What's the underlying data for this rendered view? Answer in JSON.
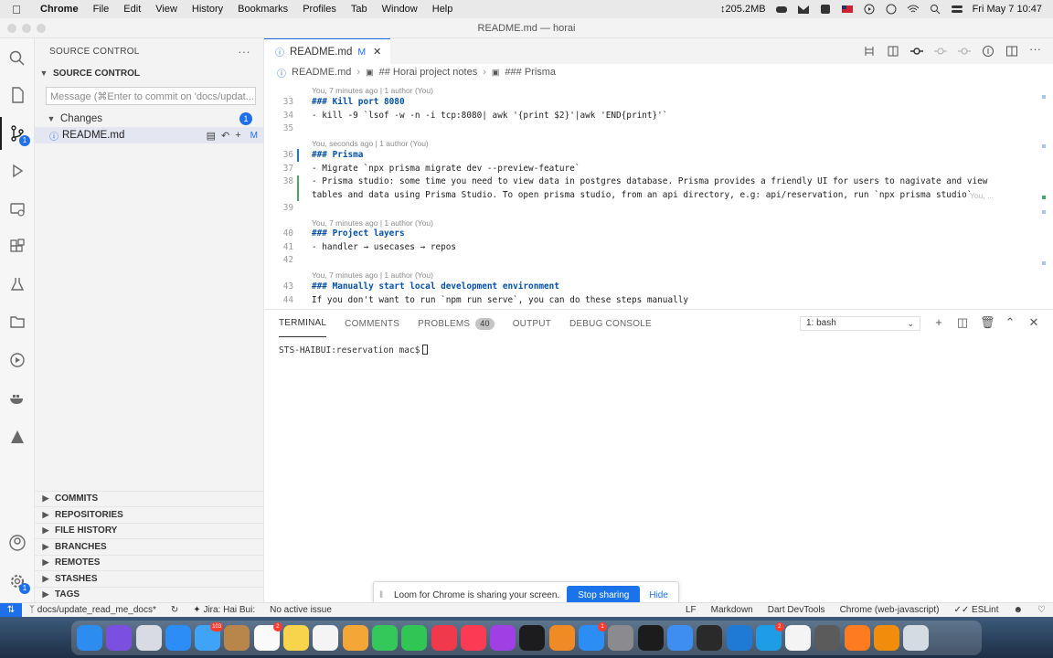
{
  "menubar": {
    "app": "Chrome",
    "menus": [
      "File",
      "Edit",
      "View",
      "History",
      "Bookmarks",
      "Profiles",
      "Tab",
      "Window",
      "Help"
    ],
    "memory": "↕205.2MB",
    "datetime": "Fri May 7  10:47"
  },
  "window": {
    "title": "README.md — horai"
  },
  "sidebar": {
    "header": "SOURCE CONTROL",
    "more": "···",
    "section": "SOURCE CONTROL",
    "commit_placeholder": "Message (⌘Enter to commit on 'docs/updat...",
    "changes_label": "Changes",
    "changes_count": "1",
    "file": {
      "name": "README.md",
      "status": "M"
    },
    "bottom_sections": [
      "COMMITS",
      "REPOSITORIES",
      "FILE HISTORY",
      "BRANCHES",
      "REMOTES",
      "STASHES",
      "TAGS"
    ]
  },
  "activity": {
    "scm_badge": "1",
    "accounts_badge": "1"
  },
  "tab": {
    "label": "README.md",
    "modified": "M",
    "close": "✕"
  },
  "breadcrumb": [
    "README.md",
    "## Horai project notes",
    "### Prisma"
  ],
  "editor": {
    "lines": [
      {
        "blame": "You, 7 minutes ago | 1 author (You)"
      },
      {
        "num": "33",
        "text": "### Kill port 8080",
        "head": true
      },
      {
        "num": "34",
        "text": "-  kill -9 `lsof -w -n -i tcp:8080| awk '{print $2}'|awk 'END{print}'`"
      },
      {
        "num": "35",
        "text": ""
      },
      {
        "blame": "You, seconds ago | 1 author (You)"
      },
      {
        "num": "36",
        "text": "### Prisma",
        "head": true
      },
      {
        "num": "37",
        "text": "- Migrate `npx prisma migrate dev --preview-feature`"
      },
      {
        "num": "38",
        "text": "- Prisma studio: some time you need to view data in postgres database. Prisma provides a friendly UI for users to nagivate and view"
      },
      {
        "num": "",
        "text": "tables and data using Prisma Studio. To open prisma studio, from an api directory, e.g: api/reservation, run `npx prisma studio`"
      },
      {
        "num": "39",
        "text": ""
      },
      {
        "blame": "You, 7 minutes ago | 1 author (You)"
      },
      {
        "num": "40",
        "text": "### Project layers",
        "head": true
      },
      {
        "num": "41",
        "text": "- handler → usecases → repos"
      },
      {
        "num": "42",
        "text": ""
      },
      {
        "blame": "You, 7 minutes ago | 1 author (You)"
      },
      {
        "num": "43",
        "text": "### Manually start local development environment",
        "head": true
      },
      {
        "num": "44",
        "text": "If you don't want to run `npm run serve`, you can do these steps manually"
      }
    ],
    "ghost_blame": "You, ..."
  },
  "panel": {
    "tabs": [
      "TERMINAL",
      "COMMENTS",
      "PROBLEMS",
      "OUTPUT",
      "DEBUG CONSOLE"
    ],
    "problems_count": "40",
    "terminal_select": "1: bash",
    "prompt": "STS-HAIBUI:reservation mac$"
  },
  "loom": {
    "message": "Loom for Chrome is sharing your screen.",
    "stop": "Stop sharing",
    "hide": "Hide"
  },
  "statusbar": {
    "branch": "docs/update_read_me_docs*",
    "jira": "Jira: Hai Bui:",
    "issue": "No active issue",
    "eol": "LF",
    "language": "Markdown",
    "devtools": "Dart DevTools",
    "chrome": "Chrome (web-javascript)",
    "eslint": "ESLint"
  },
  "dock": {
    "apps": [
      {
        "name": "finder-icon",
        "color": "#2d8cf0"
      },
      {
        "name": "siri-icon",
        "color": "#7b4fe0"
      },
      {
        "name": "launchpad-icon",
        "color": "#d8dbe3"
      },
      {
        "name": "safari-icon",
        "color": "#2b8df5"
      },
      {
        "name": "mail-icon",
        "color": "#3fa4f7",
        "badge": "103"
      },
      {
        "name": "contacts-icon",
        "color": "#b8864a"
      },
      {
        "name": "calendar-icon",
        "color": "#fafafa",
        "badge": "2"
      },
      {
        "name": "notes-icon",
        "color": "#f7d44c"
      },
      {
        "name": "reminders-icon",
        "color": "#f4f4f4"
      },
      {
        "name": "photos-icon",
        "color": "#f4a637"
      },
      {
        "name": "messages-icon",
        "color": "#34c759"
      },
      {
        "name": "facetime-icon",
        "color": "#31c653"
      },
      {
        "name": "news-icon",
        "color": "#f03a4b"
      },
      {
        "name": "music-icon",
        "color": "#fa3b53"
      },
      {
        "name": "podcasts-icon",
        "color": "#a03fe3"
      },
      {
        "name": "tv-icon",
        "color": "#1c1c1e"
      },
      {
        "name": "books-icon",
        "color": "#f08a24"
      },
      {
        "name": "appstore-icon",
        "color": "#2c8ef5",
        "badge": "1"
      },
      {
        "name": "system-preferences-icon",
        "color": "#8b8b8f"
      },
      {
        "name": "terminal-icon",
        "color": "#1c1c1c"
      },
      {
        "name": "xcode-icon",
        "color": "#3d8ef0"
      },
      {
        "name": "activity-monitor-icon",
        "color": "#2a2a2a"
      },
      {
        "name": "vscode-icon",
        "color": "#1f7ad6"
      },
      {
        "name": "skype-icon",
        "color": "#1e9ce6",
        "badge": "2"
      },
      {
        "name": "chrome-icon",
        "color": "#f4f4f4"
      },
      {
        "name": "calculator-icon",
        "color": "#5b5b5b"
      },
      {
        "name": "firefox-icon",
        "color": "#ff7b1f"
      },
      {
        "name": "vlc-icon",
        "color": "#f28c0d"
      },
      {
        "name": "trash-icon",
        "color": "#d5dbe2"
      }
    ]
  }
}
